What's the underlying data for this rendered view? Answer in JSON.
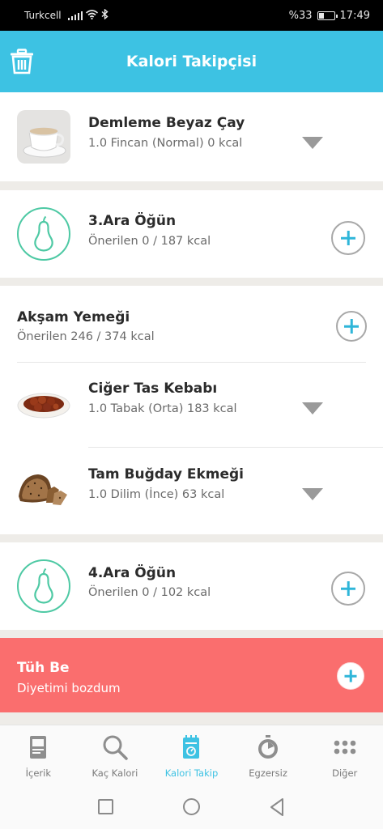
{
  "status_bar": {
    "carrier": "Turkcell",
    "battery_text": "%33",
    "battery_level": 0.33,
    "time": "17:49",
    "icons": [
      "signal-icon",
      "wifi-icon",
      "bluetooth-icon",
      "battery-icon"
    ]
  },
  "header": {
    "title": "Kalori Takipçisi",
    "left_icon": "trash-icon"
  },
  "entries": {
    "demleme": {
      "title": "Demleme Beyaz Çay",
      "detail": "1.0 Fincan (Normal) 0 kcal"
    },
    "ara3": {
      "title": "3.Ara Öğün",
      "detail": "Önerilen 0 / 187 kcal"
    },
    "aksam": {
      "title": "Akşam Yemeği",
      "detail": "Önerilen 246 / 374 kcal"
    },
    "ciger": {
      "title": "Ciğer Tas Kebabı",
      "detail": "1.0 Tabak (Orta) 183 kcal"
    },
    "ekmek": {
      "title": "Tam Buğday Ekmeği",
      "detail": "1.0 Dilim (İnce) 63 kcal"
    },
    "ara4": {
      "title": "4.Ara Öğün",
      "detail": "Önerilen 0 / 102 kcal"
    }
  },
  "tuh_be": {
    "title": "Tüh Be",
    "subtitle": "Diyetimi bozdum",
    "bg_color": "#fa6e6e"
  },
  "bottom_nav": {
    "items": [
      {
        "label": "İçerik",
        "icon": "book-icon"
      },
      {
        "label": "Kaç Kalori",
        "icon": "search-icon"
      },
      {
        "label": "Kalori Takip",
        "icon": "calendar-icon"
      },
      {
        "label": "Egzersiz",
        "icon": "stopwatch-icon"
      },
      {
        "label": "Diğer",
        "icon": "more-dots-icon"
      }
    ],
    "active_index": 2
  },
  "colors": {
    "accent": "#3dc2e3",
    "pear": "#4ec9a4",
    "tuh_be": "#fa6e6e"
  }
}
